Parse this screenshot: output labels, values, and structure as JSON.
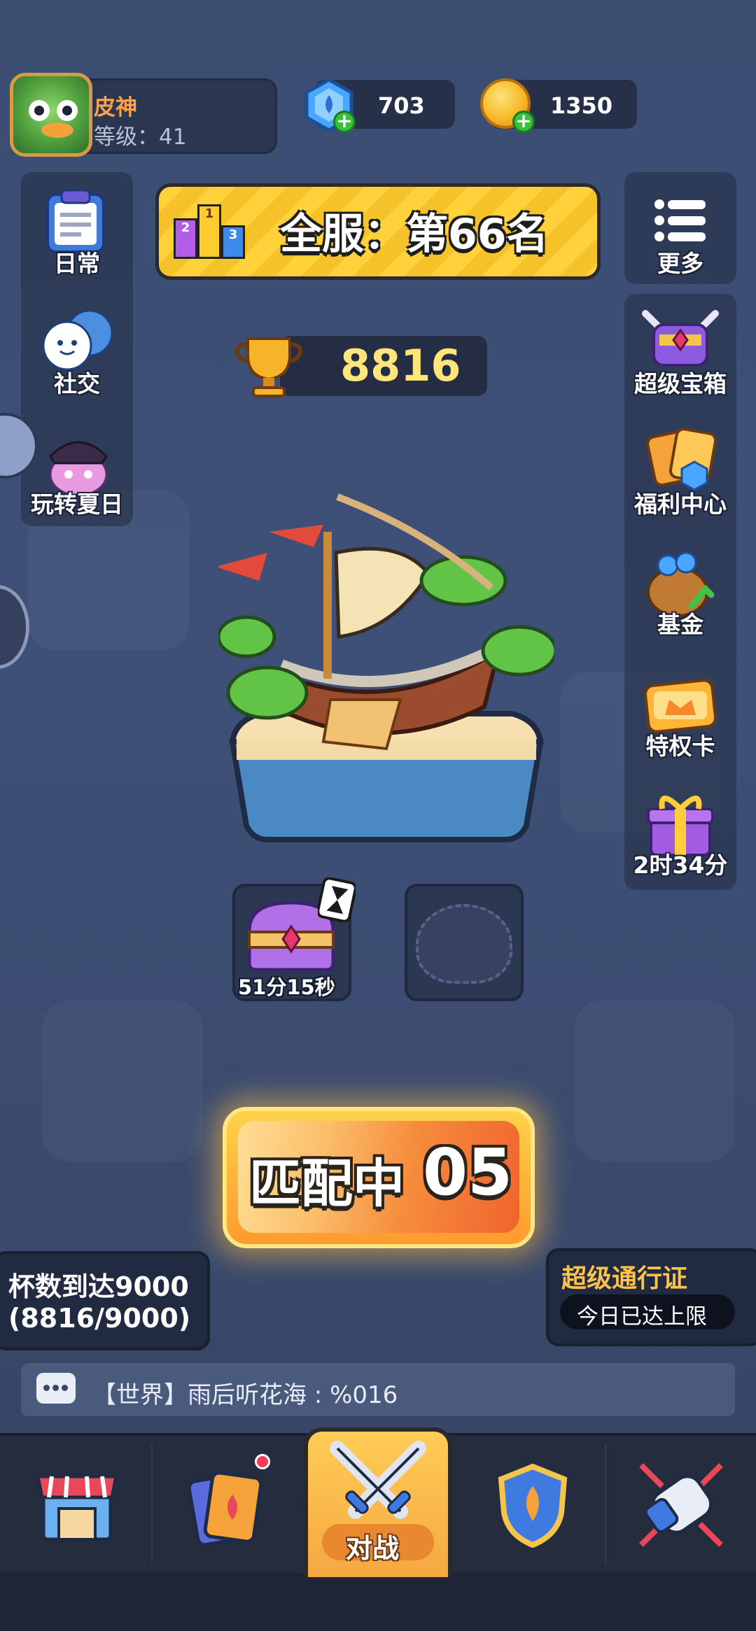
{
  "player": {
    "name": "皮神",
    "level_text": "等级：41"
  },
  "currencies": {
    "gems": "703",
    "coins": "1350"
  },
  "left_menu": [
    {
      "label": "日常",
      "icon": "clipboard-icon"
    },
    {
      "label": "社交",
      "icon": "chat-bubbles-icon"
    },
    {
      "label": "玩转夏日",
      "icon": "pirate-cat-icon"
    }
  ],
  "right_menu": [
    {
      "label": "更多",
      "icon": "menu-list-icon"
    },
    {
      "label": "超级宝箱",
      "icon": "super-chest-icon"
    },
    {
      "label": "福利中心",
      "icon": "welfare-cards-icon"
    },
    {
      "label": "基金",
      "icon": "money-bag-icon"
    },
    {
      "label": "特权卡",
      "icon": "privilege-card-icon"
    },
    {
      "label": "2时34分",
      "icon": "gift-box-icon"
    }
  ],
  "rank": {
    "text": "全服：第66名",
    "podium": [
      "2",
      "1",
      "3"
    ]
  },
  "trophies": "8816",
  "chest_slots": [
    {
      "timer": "51分15秒",
      "state": "unlocking"
    },
    {
      "timer": "",
      "state": "empty"
    }
  ],
  "match": {
    "label": "匹配中",
    "count": "05"
  },
  "trophy_goal": {
    "line1": "杯数到达9000",
    "line2": "(8816/9000)"
  },
  "battle_pass": {
    "title": "超级通行证",
    "status": "今日已达上限"
  },
  "chat": {
    "text": "【世界】雨后听花海 : %016"
  },
  "nav": [
    {
      "icon": "shop-icon",
      "label": ""
    },
    {
      "icon": "cards-icon",
      "label": "",
      "badge": true
    },
    {
      "icon": "crossed-swords-icon",
      "label": "对战",
      "active": true
    },
    {
      "icon": "clan-shield-icon",
      "label": ""
    },
    {
      "icon": "fist-icon",
      "label": ""
    }
  ],
  "colors": {
    "accent_yellow": "#ffd23b",
    "name_orange": "#ffa24a",
    "trophy_gold": "#ffe57a",
    "badge_red": "#ff3b5c"
  }
}
